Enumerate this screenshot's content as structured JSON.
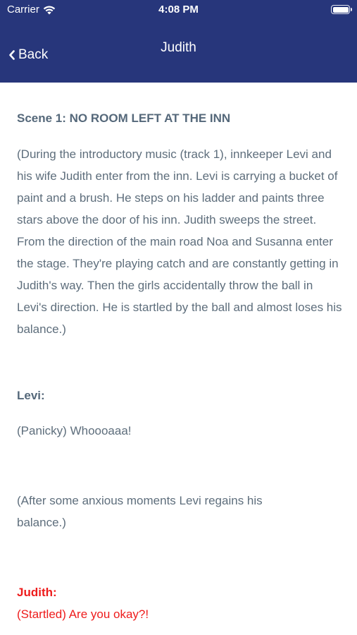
{
  "status_bar": {
    "carrier": "Carrier",
    "time": "4:08 PM"
  },
  "nav": {
    "back_label": "Back",
    "title": "Judith"
  },
  "script": {
    "scene_title": "Scene 1: NO ROOM LEFT AT THE INN",
    "intro_direction": "(During the introductory music (track 1), innkeeper Levi and his wife Judith enter from the inn. Levi is carrying a bucket of paint and a brush. He steps on his ladder and paints three stars above the door of his inn. Judith sweeps the street. From the direction of the main road Noa and Susanna enter the stage. They're playing catch and are constantly getting in Judith's way. Then the girls accidentally throw the ball in Levi's direction. He is startled by the ball and almost loses his balance.)",
    "line1_speaker": "Levi:",
    "line1_text": "(Panicky) Whoooaaa!",
    "direction2": "(After some anxious moments Levi regains his balance.)",
    "line2_speaker": "Judith:",
    "line2_text": "(Startled) Are you okay?!"
  },
  "colors": {
    "header_bg": "#27367b",
    "body_text": "#5e6e7c",
    "highlight_red": "#ee1c1c"
  }
}
